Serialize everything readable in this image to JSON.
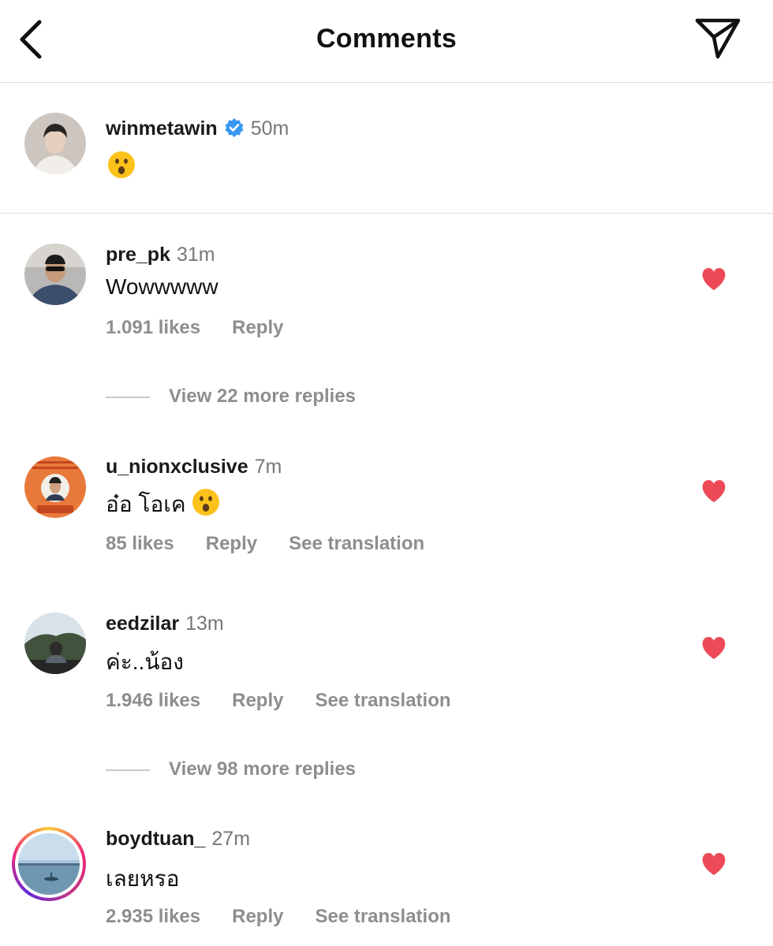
{
  "header": {
    "title": "Comments",
    "back_icon": "chevron-left-icon",
    "send_icon": "paper-plane-icon"
  },
  "caption": {
    "username": "winmetawin",
    "verified": true,
    "time": "50m",
    "text_emoji": "surprised-face-emoji"
  },
  "comments": [
    {
      "username": "pre_pk",
      "time": "31m",
      "text": "Wowwwww",
      "likes": "1.091 likes",
      "reply": "Reply",
      "liked": true
    },
    {
      "username": "u_nionxclusive",
      "time": "7m",
      "text": "อ๋อ โอเค",
      "trailing_emoji": "surprised-face-emoji",
      "likes": "85 likes",
      "reply": "Reply",
      "translate": "See translation",
      "liked": true
    },
    {
      "username": "eedzilar",
      "time": "13m",
      "text": "ค่ะ..น้อง",
      "likes": "1.946 likes",
      "reply": "Reply",
      "translate": "See translation",
      "liked": true
    },
    {
      "username": "boydtuan_",
      "time": "27m",
      "text": "เลยหรอ",
      "likes": "2.935 likes",
      "reply": "Reply",
      "translate": "See translation",
      "liked": true,
      "story_ring": true
    }
  ],
  "view_replies": [
    "View 22 more replies",
    "View 98 more replies"
  ],
  "colors": {
    "heart": "#ed4956",
    "verified": "#3897f0",
    "muted_text": "#8e8e8e",
    "divider": "#dbdbdb"
  }
}
